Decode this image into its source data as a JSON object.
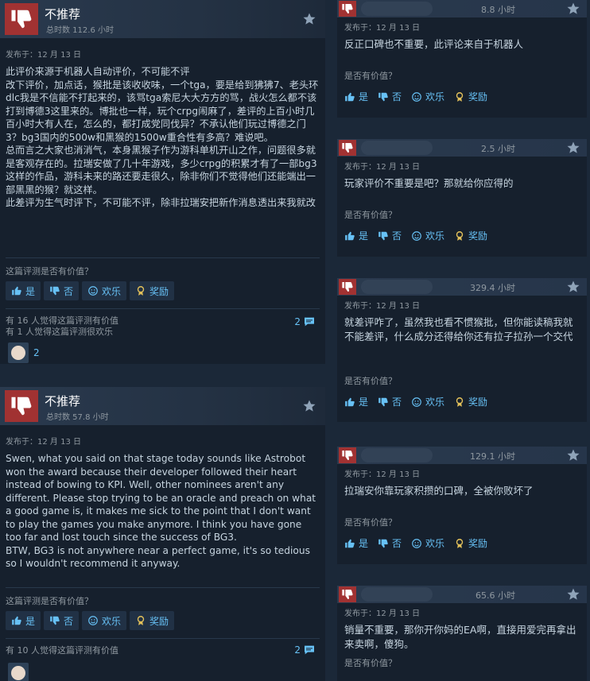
{
  "left_reviews": [
    {
      "recommendation": "不推荐",
      "hours": "总时数 112.6 小时",
      "posted": "发布于：12 月 13 日",
      "paragraphs": [
        "此评价来源于机器人自动评价，不可能不评",
        "改下评价，加点话，猴批是该收收味，一个tga，要是给到狒狒7、老头环dlc我是不信能不打起来的，该骂tga索尼大大方方的骂，战火怎么都不该打到博德3这里来的。博批也一样，玩个crpg闹麻了，差评的上百小时几百小时大有人在，怎么的，都打成党同伐异？不承认他们玩过博德之门3？bg3国内的500w和黑猴的1500w重合性有多高？难说吧。",
        "总而言之大家也消消气，本身黑猴子作为游科单机开山之作，问题很多就是客观存在的。拉瑞安做了几十年游戏，多少crpg的积累才有了一部bg3这样的作品，游科未来的路还要走很久，除非你们不觉得他们还能端出一部黑黑的猴？就这样。",
        "此差评为生气时评下，不可能不评，除非拉瑞安把新作消息透出来我就改"
      ],
      "helpful_question": "这篇评测是否有价值？",
      "buttons": [
        "是",
        "否",
        "欢乐",
        "奖励"
      ],
      "stats": [
        "有 16 人觉得这篇评测有价值",
        "有 1 人觉得这篇评测很欢乐"
      ],
      "comment_count": "2",
      "award_count": "2"
    },
    {
      "recommendation": "不推荐",
      "hours": "总时数 57.8 小时",
      "posted": "发布于：12 月 13 日",
      "paragraphs": [
        "Swen, what you said on that stage today sounds like Astrobot won the award because their developer followed their heart instead of bowing to KPI. Well, other nominees aren't any different. Please stop trying to be an oracle and preach on what a good game is, it makes me sick to the point that I don't want to play the games you make anymore. I think you have gone too far and lost touch since the success of BG3.",
        "BTW, BG3 is not anywhere near a perfect game, it's so tedious so I wouldn't recommend it anyway."
      ],
      "helpful_question": "这篇评测是否有价值？",
      "buttons": [
        "是",
        "否",
        "欢乐",
        "奖励"
      ],
      "stats": [
        "有 10 人觉得这篇评测有价值"
      ],
      "comment_count": "2",
      "award_count": ""
    }
  ],
  "right_reviews": [
    {
      "hours": "8.8 小时",
      "posted": "发布于：12 月 13 日",
      "text": "反正口碑也不重要，此评论来自于机器人",
      "helpful_question": "是否有价值？",
      "buttons": [
        "是",
        "否",
        "欢乐",
        "奖励"
      ]
    },
    {
      "hours": "2.5 小时",
      "posted": "发布于：12 月 13 日",
      "text": "玩家评价不重要是吧？那就给你应得的",
      "helpful_question": "是否有价值？",
      "buttons": [
        "是",
        "否",
        "欢乐",
        "奖励"
      ]
    },
    {
      "hours": "329.4 小时",
      "posted": "发布于：12 月 13 日",
      "text": "就差评咋了，虽然我也看不惯猴批，但你能读稿我就不能差评，什么成分还得给你还有拉子拉孙一个交代",
      "helpful_question": "是否有价值？",
      "buttons": [
        "是",
        "否",
        "欢乐",
        "奖励"
      ]
    },
    {
      "hours": "129.1 小时",
      "posted": "发布于：12 月 13 日",
      "text": "拉瑞安你靠玩家积攒的口碑，全被你败坏了",
      "helpful_question": "是否有价值？",
      "buttons": [
        "是",
        "否",
        "欢乐",
        "奖励"
      ]
    },
    {
      "hours": "65.6 小时",
      "posted": "发布于：12 月 13 日",
      "text": "销量不重要，那你开你妈的EA啊，直接用爱完再拿出来卖啊，傻狗。",
      "helpful_question": "是否有价值？",
      "buttons": []
    }
  ],
  "colors": {
    "background": "#1b2838",
    "card": "#16202d",
    "thumb_down": "#a13232",
    "link": "#67c1f5",
    "muted": "#8f98a0"
  },
  "icons": [
    "thumbs-down-icon",
    "award-star-icon",
    "thumbs-up-icon",
    "smiley-icon",
    "ribbon-icon",
    "comment-icon",
    "avatar-icon"
  ]
}
